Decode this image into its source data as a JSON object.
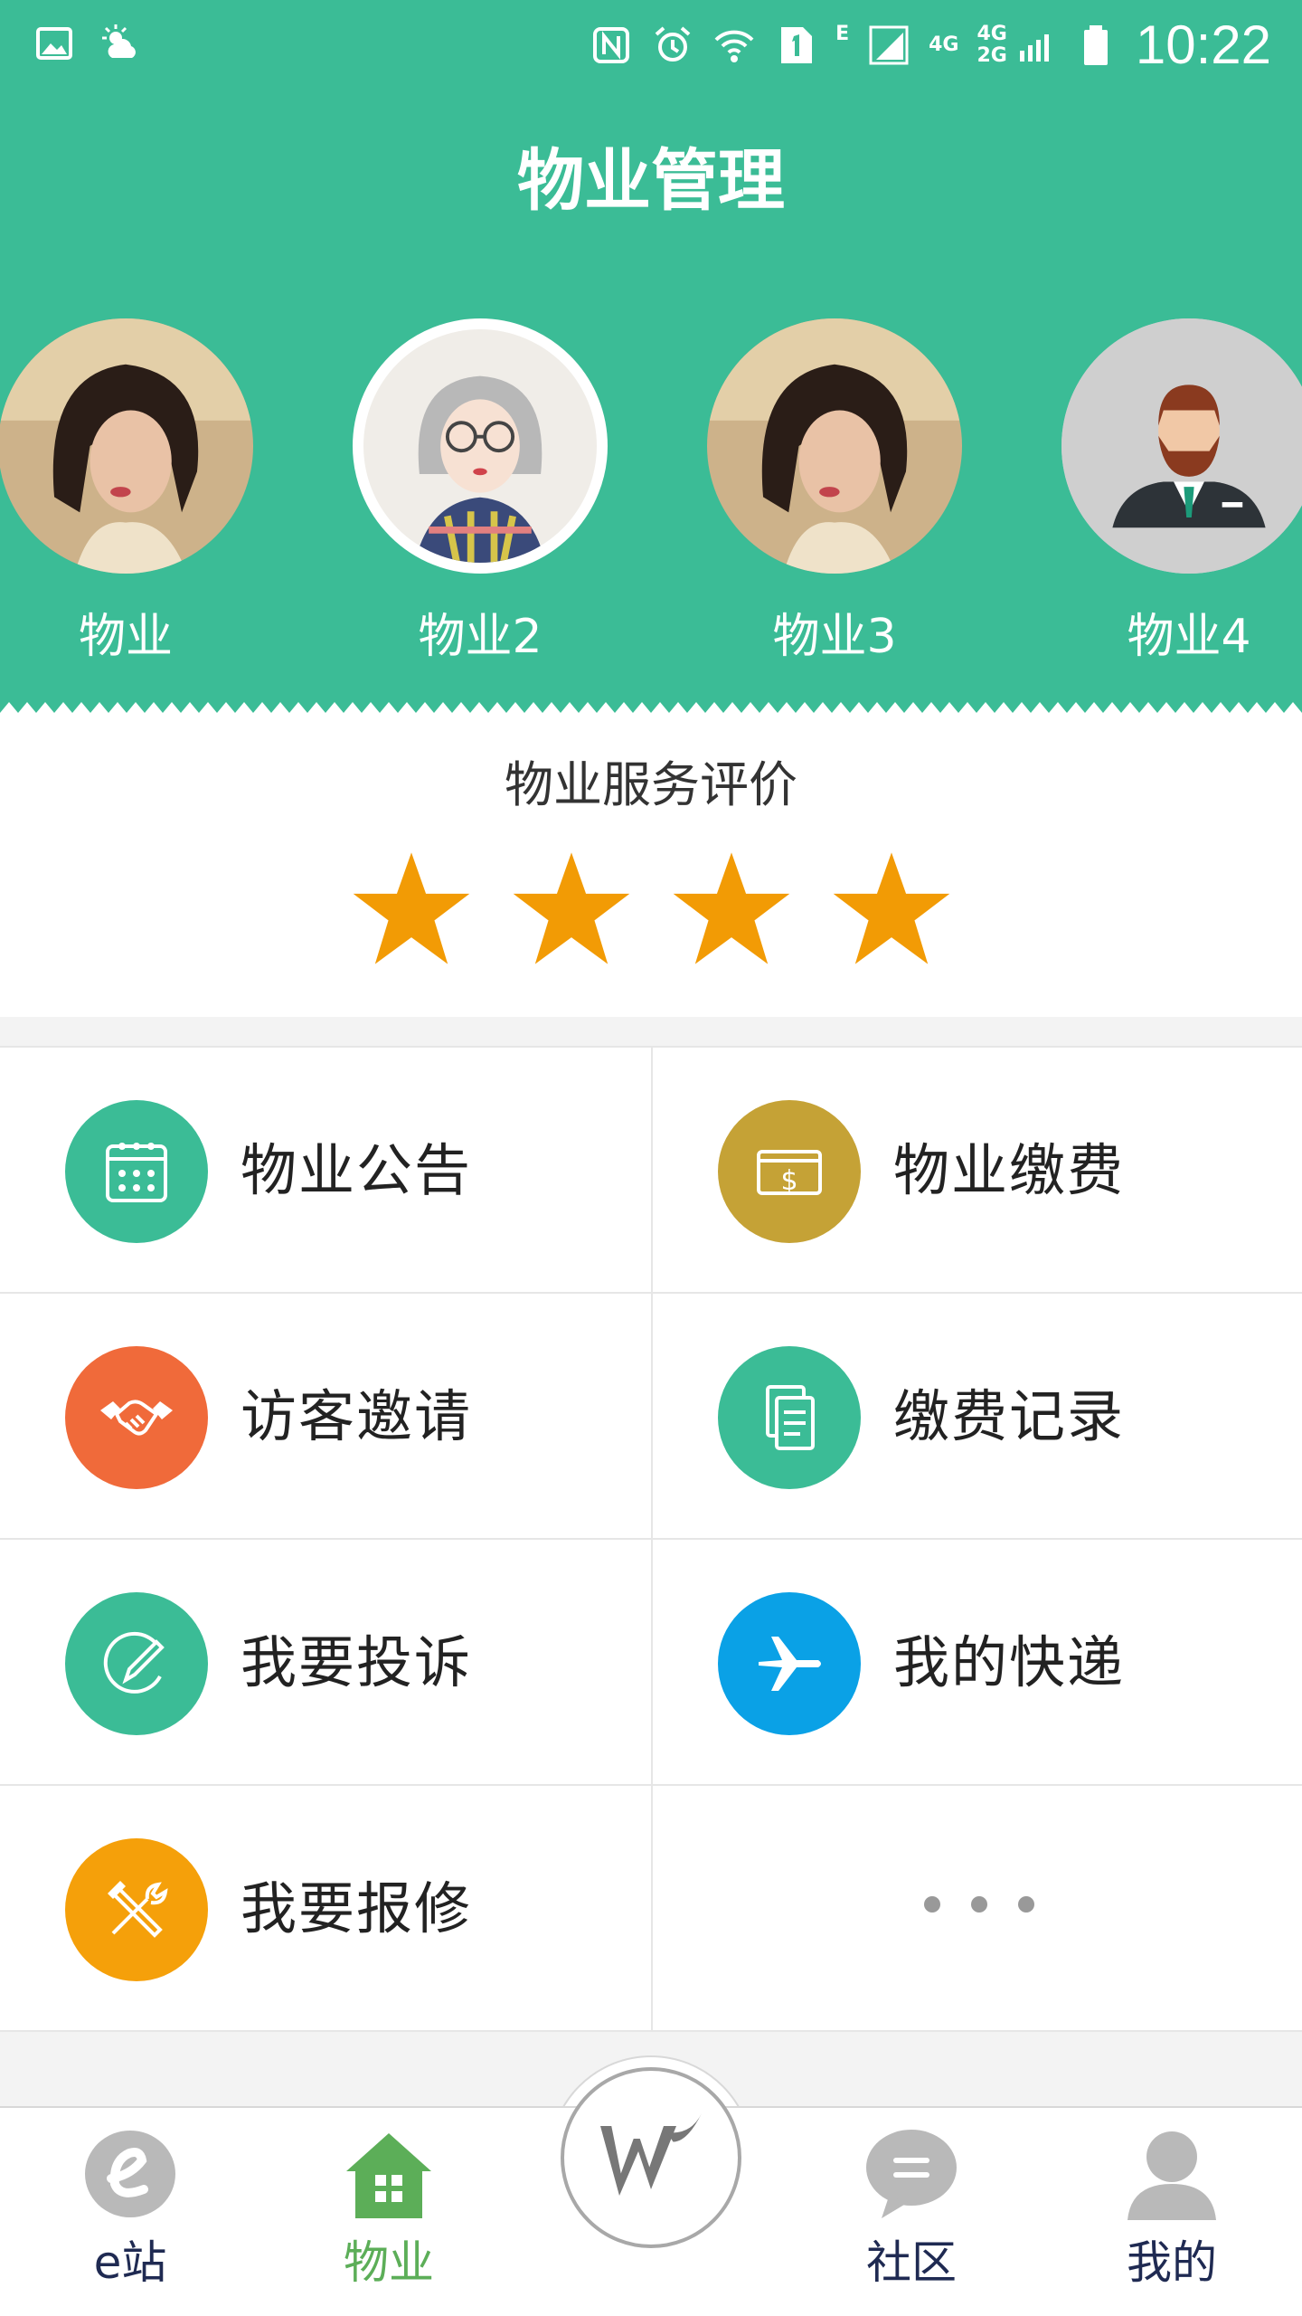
{
  "status_bar": {
    "time": "10:22",
    "network_labels": [
      "E",
      "4G",
      "4G",
      "2G"
    ]
  },
  "header": {
    "title": "物业管理"
  },
  "properties": [
    {
      "name": "物业",
      "avatar": "woman-photo"
    },
    {
      "name": "物业2",
      "avatar": "illustrated-girl"
    },
    {
      "name": "物业3",
      "avatar": "woman-photo"
    },
    {
      "name": "物业4",
      "avatar": "man-in-suit"
    }
  ],
  "rating": {
    "title": "物业服务评价",
    "stars": 4,
    "star_color": "#f29b05"
  },
  "services": [
    {
      "label": "物业公告",
      "icon": "calendar-icon",
      "color": "#3bbc96"
    },
    {
      "label": "物业缴费",
      "icon": "payment-icon",
      "color": "#c5a236"
    },
    {
      "label": "访客邀请",
      "icon": "handshake-icon",
      "color": "#f06a3a"
    },
    {
      "label": "缴费记录",
      "icon": "documents-icon",
      "color": "#3bbc96"
    },
    {
      "label": "我要投诉",
      "icon": "pencil-icon",
      "color": "#3bbc96"
    },
    {
      "label": "我的快递",
      "icon": "airplane-icon",
      "color": "#0aa1e6"
    },
    {
      "label": "我要报修",
      "icon": "tools-icon",
      "color": "#f5a00a"
    }
  ],
  "tabbar": {
    "items": [
      {
        "label": "e站",
        "icon": "e-station-icon"
      },
      {
        "label": "物业",
        "icon": "home-icon",
        "active": true
      },
      {
        "label": "社区",
        "icon": "chat-bubble-icon"
      },
      {
        "label": "我的",
        "icon": "user-icon"
      }
    ],
    "center_icon": "w-logo-icon"
  },
  "colors": {
    "primary": "#3bbc96",
    "active_tab": "#5cae58",
    "tab_text": "#1f2a52"
  }
}
